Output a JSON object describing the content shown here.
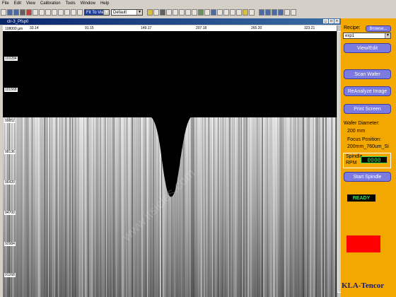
{
  "menu": [
    "File",
    "Edit",
    "View",
    "Calibration",
    "Tools",
    "Window",
    "Help"
  ],
  "toolbar": {
    "zoom_select": "Fit To View",
    "profile_select": "Default"
  },
  "doc_window": {
    "title": "clr-3_Pfsp0"
  },
  "plot": {
    "x_ticks": [
      "33.14",
      "91.15",
      "149.17",
      "207.18",
      "265.20",
      "323.21"
    ],
    "y_ticks": [
      "108000 µm",
      "103284",
      "101568",
      "99852",
      "98136",
      "96420",
      "94700",
      "92984",
      "91268"
    ],
    "watermark": "www.itsicles.com"
  },
  "panel": {
    "recipe_label": "Recipe:",
    "browse_label": "Browse...",
    "recipe_value": "exp1",
    "view_edit": "View/Edit",
    "scan_wafer": "Scan Wafer",
    "reanalyze": "ReAnalyze Image",
    "print_screen": "Print Screen",
    "wafer_diameter_label": "Wafer Diameter:",
    "wafer_diameter_value": "200 mm",
    "focus_label": "Focus Position:",
    "focus_value": "200mm_760um_Si",
    "spindle_label": "Spindle",
    "rpm_label": "RPM",
    "rpm_value": "0000",
    "start_spindle": "Start Spindle",
    "status": "READY",
    "brand": "KLA-Tencor"
  },
  "colors": {
    "panel_bg": "#f2a800",
    "button": "#7a7ae0",
    "status_text": "#39e05a",
    "alarm": "#ff0000"
  }
}
